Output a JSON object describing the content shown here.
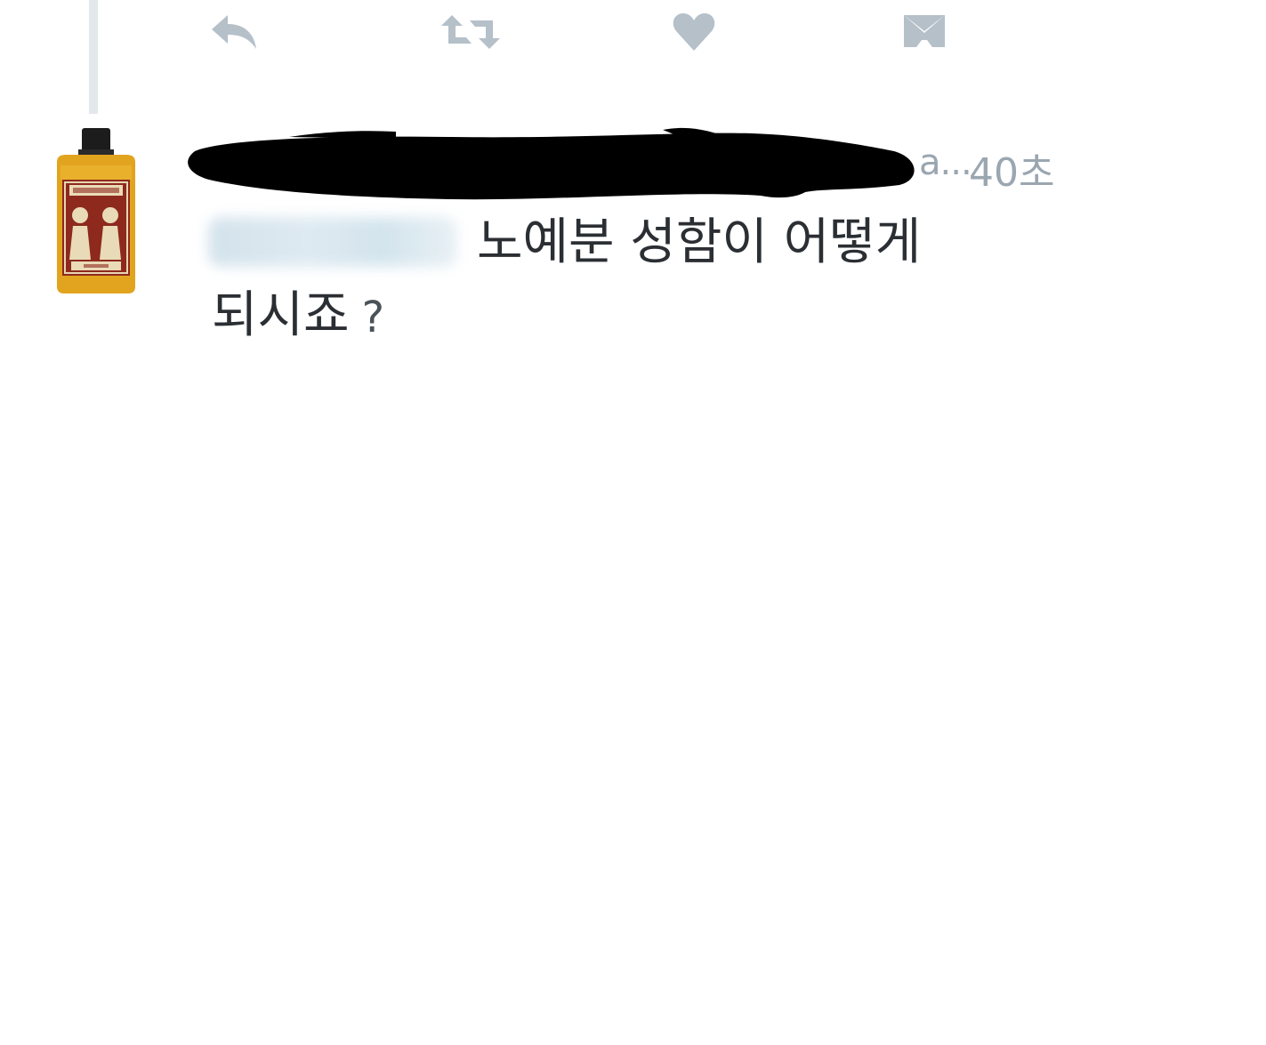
{
  "actions": {
    "reply_icon": "reply-icon",
    "retweet_icon": "retweet-icon",
    "like_icon": "heart-icon",
    "dm_icon": "envelope-icon",
    "icon_color": "#b5c0c9"
  },
  "tweet": {
    "author_truncated": "a...",
    "timestamp": "40초",
    "text_line1": "노예분 성함이 어떻게",
    "text_line2": "되시죠",
    "text_punct": "?",
    "meta_color": "#9aa6b0",
    "text_color": "#2b2f33"
  }
}
